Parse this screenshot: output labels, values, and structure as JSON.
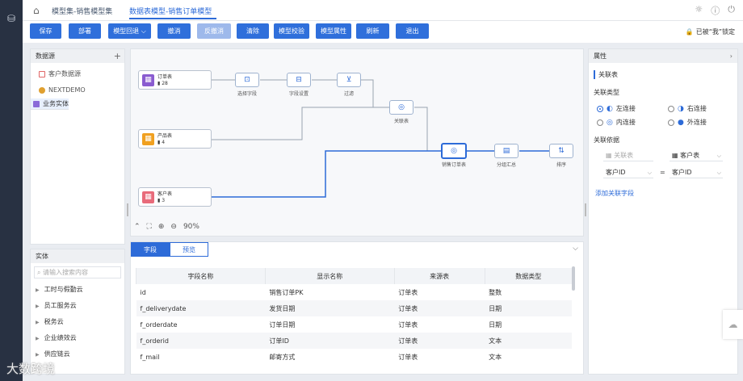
{
  "nav": {
    "home_icon": "home-icon",
    "crumb1": "模型集-销售模型集",
    "crumb2": "数据表模型-销售订单模型",
    "icons": [
      "bulb-icon",
      "help-icon",
      "power-icon"
    ]
  },
  "toolbar": {
    "buttons": [
      {
        "label": "保存",
        "disabled": false
      },
      {
        "label": "部署",
        "disabled": false
      },
      {
        "label": "模型回退 ⌵",
        "disabled": false
      },
      {
        "label": "撤消",
        "disabled": false
      },
      {
        "label": "反撤消",
        "disabled": true
      },
      {
        "label": "清除",
        "disabled": false
      },
      {
        "label": "模型校验",
        "disabled": false
      },
      {
        "label": "模型属性",
        "disabled": false
      },
      {
        "label": "刷新",
        "disabled": false
      },
      {
        "label": "退出",
        "disabled": false
      }
    ],
    "lock": "已被“我”锁定"
  },
  "datasource": {
    "title": "数据源",
    "items": [
      {
        "label": "客户数据源",
        "color": "#e06666"
      },
      {
        "label": "NEXTDEMO",
        "color": "#e0a030"
      },
      {
        "label": "业务实体",
        "color": "#8a6bd8"
      }
    ]
  },
  "entity": {
    "title": "实体",
    "placeholder": "请输入搜索内容",
    "items": [
      "工时与假勤云",
      "员工服务云",
      "税务云",
      "企业绩效云",
      "供应链云"
    ]
  },
  "canvas": {
    "nodes": [
      {
        "name": "订单表",
        "count": "28",
        "color": "#8a5cd0"
      },
      {
        "name": "产品表",
        "count": "4",
        "color": "#f0a020"
      },
      {
        "name": "客户表",
        "count": "3",
        "color": "#e86b7a"
      }
    ],
    "ops": {
      "select": "选择字段",
      "setting": "字段设置",
      "filter": "过滤",
      "join": "关联表",
      "order_join": "销售订单表",
      "group": "分组汇总",
      "sort": "排序"
    },
    "zoom": "90%"
  },
  "bottom": {
    "tabs": [
      "字段",
      "预览"
    ],
    "columns": [
      "字段名称",
      "显示名称",
      "来源表",
      "数据类型"
    ],
    "rows": [
      [
        "id",
        "销售订单PK",
        "订单表",
        "整数"
      ],
      [
        "f_deliverydate",
        "发货日期",
        "订单表",
        "日期"
      ],
      [
        "f_orderdate",
        "订单日期",
        "订单表",
        "日期"
      ],
      [
        "f_orderid",
        "订单ID",
        "订单表",
        "文本"
      ],
      [
        "f_mail",
        "邮寄方式",
        "订单表",
        "文本"
      ]
    ]
  },
  "props": {
    "title": "属性",
    "section": "关联表",
    "join_type": "关联类型",
    "options": [
      "左连接",
      "右连接",
      "内连接",
      "外连接"
    ],
    "selected": "左连接",
    "basis": "关联依据",
    "left_table": "关联表",
    "right_table": "客户表",
    "left_field": "客户ID",
    "right_field": "客户ID",
    "eq": "=",
    "add": "添加关联字段"
  },
  "watermark": "大数跨境"
}
